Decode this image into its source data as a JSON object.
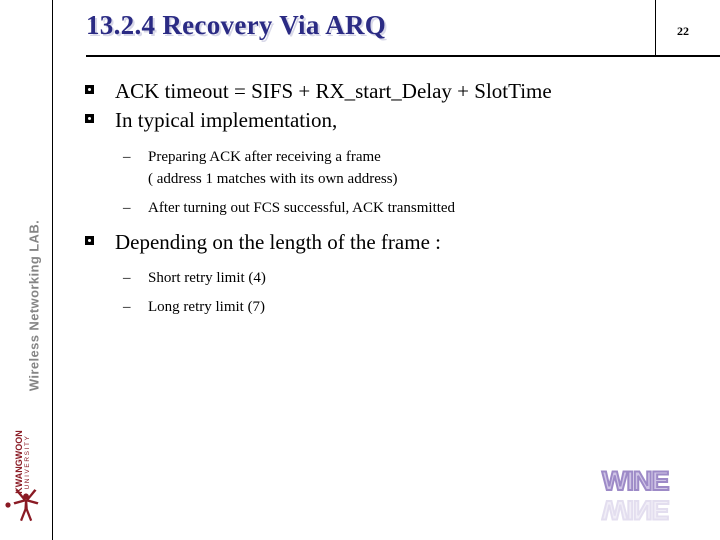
{
  "header": {
    "title": "13.2.4 Recovery Via ARQ",
    "page_number": "22",
    "title_color": "#2b2b84"
  },
  "sidebar": {
    "lab_name": "Wireless Networking LAB.",
    "lab_name_color": "#858585",
    "logo": {
      "university_name": "KWANGWOON",
      "university_sub": "UNIVERSITY",
      "color": "#8a1a24",
      "mark_icon": "person-figure-icon"
    }
  },
  "content": {
    "bullets": [
      {
        "level": 1,
        "bullet_icon": "square-bullet-icon",
        "text": "ACK timeout = SIFS + RX_start_Delay + SlotTime"
      },
      {
        "level": 1,
        "bullet_icon": "square-bullet-icon",
        "text": "In typical implementation,"
      },
      {
        "level": 2,
        "bullet_icon": "dash-bullet-icon",
        "dash": "–",
        "text": "Preparing ACK after receiving a frame",
        "continuation": "( address 1 matches with its own address)"
      },
      {
        "level": 2,
        "bullet_icon": "dash-bullet-icon",
        "dash": "–",
        "text": "After turning out FCS successful, ACK transmitted"
      },
      {
        "level": 1,
        "bullet_icon": "square-bullet-icon",
        "text": "Depending on the length of the frame :"
      },
      {
        "level": 2,
        "bullet_icon": "dash-bullet-icon",
        "dash": "–",
        "text": "Short retry limit (4)"
      },
      {
        "level": 2,
        "bullet_icon": "dash-bullet-icon",
        "dash": "–",
        "text": "Long retry limit (7)"
      }
    ]
  },
  "footer": {
    "wine_logo": {
      "text": "WINE",
      "color": "#9d8ac7"
    }
  }
}
